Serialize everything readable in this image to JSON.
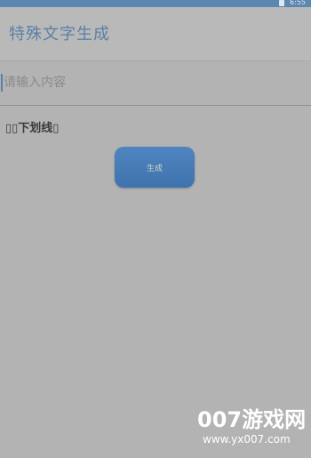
{
  "status_bar": {
    "time": "6:55"
  },
  "header": {
    "title": "特殊文字生成"
  },
  "input": {
    "placeholder": "请输入内容",
    "value": ""
  },
  "result": {
    "text": "▯▯下划线▯"
  },
  "actions": {
    "generate_label": "生成"
  },
  "watermark": {
    "brand": "007游戏网",
    "url": "www.yx007.com"
  },
  "colors": {
    "accent": "#5b7fa8",
    "button": "#4a7db5",
    "background": "#b3b3b3"
  }
}
